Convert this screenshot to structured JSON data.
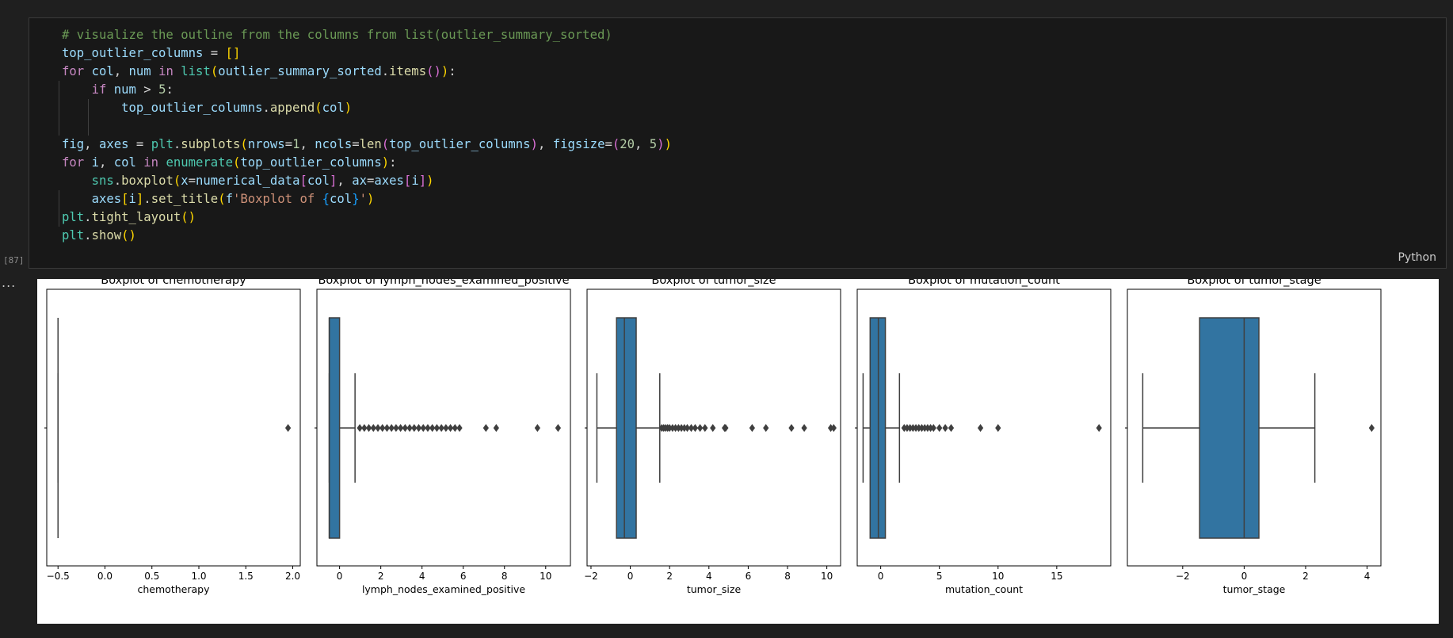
{
  "cell": {
    "execution_count": "[87]",
    "language": "Python",
    "output_menu": "...",
    "code_lines": [
      [
        [
          "cm",
          "# visualize the outline from the columns from list(outlier_summary_sorted)"
        ]
      ],
      [
        [
          "va",
          "top_outlier_columns"
        ],
        [
          "op",
          " = "
        ],
        [
          "b1",
          "[]"
        ]
      ],
      [
        [
          "kw",
          "for "
        ],
        [
          "va",
          "col"
        ],
        [
          "op",
          ", "
        ],
        [
          "va",
          "num"
        ],
        [
          "kw",
          " in "
        ],
        [
          "bi",
          "list"
        ],
        [
          "b1",
          "("
        ],
        [
          "va",
          "outlier_summary_sorted"
        ],
        [
          "op",
          "."
        ],
        [
          "fn",
          "items"
        ],
        [
          "b2",
          "()"
        ],
        [
          "b1",
          ")"
        ],
        [
          "op",
          ":"
        ]
      ],
      [
        [
          "op",
          "    "
        ],
        [
          "kw",
          "if "
        ],
        [
          "va",
          "num"
        ],
        [
          "op",
          " > "
        ],
        [
          "nu",
          "5"
        ],
        [
          "op",
          ":"
        ]
      ],
      [
        [
          "op",
          "        "
        ],
        [
          "va",
          "top_outlier_columns"
        ],
        [
          "op",
          "."
        ],
        [
          "fn",
          "append"
        ],
        [
          "b1",
          "("
        ],
        [
          "va",
          "col"
        ],
        [
          "b1",
          ")"
        ]
      ],
      [],
      [
        [
          "va",
          "fig"
        ],
        [
          "op",
          ", "
        ],
        [
          "va",
          "axes"
        ],
        [
          "op",
          " = "
        ],
        [
          "bi",
          "plt"
        ],
        [
          "op",
          "."
        ],
        [
          "fn",
          "subplots"
        ],
        [
          "b1",
          "("
        ],
        [
          "va",
          "nrows"
        ],
        [
          "op",
          "="
        ],
        [
          "nu",
          "1"
        ],
        [
          "op",
          ", "
        ],
        [
          "va",
          "ncols"
        ],
        [
          "op",
          "="
        ],
        [
          "fn",
          "len"
        ],
        [
          "b2",
          "("
        ],
        [
          "va",
          "top_outlier_columns"
        ],
        [
          "b2",
          ")"
        ],
        [
          "op",
          ", "
        ],
        [
          "va",
          "figsize"
        ],
        [
          "op",
          "="
        ],
        [
          "b2",
          "("
        ],
        [
          "nu",
          "20"
        ],
        [
          "op",
          ", "
        ],
        [
          "nu",
          "5"
        ],
        [
          "b2",
          ")"
        ],
        [
          "b1",
          ")"
        ]
      ],
      [
        [
          "kw",
          "for "
        ],
        [
          "va",
          "i"
        ],
        [
          "op",
          ", "
        ],
        [
          "va",
          "col"
        ],
        [
          "kw",
          " in "
        ],
        [
          "bi",
          "enumerate"
        ],
        [
          "b1",
          "("
        ],
        [
          "va",
          "top_outlier_columns"
        ],
        [
          "b1",
          ")"
        ],
        [
          "op",
          ":"
        ]
      ],
      [
        [
          "op",
          "    "
        ],
        [
          "bi",
          "sns"
        ],
        [
          "op",
          "."
        ],
        [
          "fn",
          "boxplot"
        ],
        [
          "b1",
          "("
        ],
        [
          "va",
          "x"
        ],
        [
          "op",
          "="
        ],
        [
          "va",
          "numerical_data"
        ],
        [
          "b2",
          "["
        ],
        [
          "va",
          "col"
        ],
        [
          "b2",
          "]"
        ],
        [
          "op",
          ", "
        ],
        [
          "va",
          "ax"
        ],
        [
          "op",
          "="
        ],
        [
          "va",
          "axes"
        ],
        [
          "b2",
          "["
        ],
        [
          "va",
          "i"
        ],
        [
          "b2",
          "]"
        ],
        [
          "b1",
          ")"
        ]
      ],
      [
        [
          "op",
          "    "
        ],
        [
          "va",
          "axes"
        ],
        [
          "b1",
          "["
        ],
        [
          "va",
          "i"
        ],
        [
          "b1",
          "]"
        ],
        [
          "op",
          "."
        ],
        [
          "fn",
          "set_title"
        ],
        [
          "b1",
          "("
        ],
        [
          "va",
          "f"
        ],
        [
          "st",
          "'Boxplot of "
        ],
        [
          "b3",
          "{"
        ],
        [
          "va",
          "col"
        ],
        [
          "b3",
          "}"
        ],
        [
          "st",
          "'"
        ],
        [
          "b1",
          ")"
        ]
      ],
      [
        [
          "bi",
          "plt"
        ],
        [
          "op",
          "."
        ],
        [
          "fn",
          "tight_layout"
        ],
        [
          "b1",
          "()"
        ]
      ],
      [
        [
          "bi",
          "plt"
        ],
        [
          "op",
          "."
        ],
        [
          "fn",
          "show"
        ],
        [
          "b1",
          "()"
        ]
      ]
    ]
  },
  "colors": {
    "box_fill": "#3274a1",
    "line": "#3f3f3f"
  },
  "chart_data": [
    {
      "type": "boxplot",
      "title": "Boxplot of chemotherapy",
      "xlabel": "chemotherapy",
      "xlim": [
        -0.62,
        2.08
      ],
      "xticks": [
        -0.5,
        0.0,
        0.5,
        1.0,
        1.5,
        2.0
      ],
      "xtick_labels": [
        "−0.5",
        "0.0",
        "0.5",
        "1.0",
        "1.5",
        "2.0"
      ],
      "whisker_low": -0.5,
      "q1": -0.5,
      "median": -0.5,
      "q3": -0.5,
      "whisker_high": -0.5,
      "outliers": [
        1.95
      ]
    },
    {
      "type": "boxplot",
      "title": "Boxplot of lymph_nodes_examined_positive",
      "xlabel": "lymph_nodes_examined_positive",
      "xlim": [
        -1.1,
        11.2
      ],
      "xticks": [
        0,
        2,
        4,
        6,
        8,
        10
      ],
      "xtick_labels": [
        "0",
        "2",
        "4",
        "6",
        "8",
        "10"
      ],
      "whisker_low": -0.5,
      "q1": -0.5,
      "median": -0.5,
      "q3": 0.0,
      "whisker_high": 0.75,
      "outliers": [
        0.98,
        1.2,
        1.42,
        1.64,
        1.86,
        2.08,
        2.3,
        2.52,
        2.74,
        2.96,
        3.18,
        3.4,
        3.62,
        3.84,
        4.06,
        4.28,
        4.5,
        4.72,
        4.94,
        5.16,
        5.38,
        5.6,
        5.82,
        7.1,
        7.6,
        9.6,
        10.6
      ]
    },
    {
      "type": "boxplot",
      "title": "Boxplot of tumor_size",
      "xlabel": "tumor_size",
      "xlim": [
        -2.2,
        10.7
      ],
      "xticks": [
        -2,
        0,
        2,
        4,
        6,
        8,
        10
      ],
      "xtick_labels": [
        "−2",
        "0",
        "2",
        "4",
        "6",
        "8",
        "10"
      ],
      "whisker_low": -1.7,
      "q1": -0.7,
      "median": -0.3,
      "q3": 0.3,
      "whisker_high": 1.5,
      "outliers": [
        1.6,
        1.7,
        1.8,
        1.9,
        2.0,
        2.15,
        2.3,
        2.45,
        2.6,
        2.75,
        2.9,
        3.1,
        3.3,
        3.55,
        3.8,
        4.2,
        4.8,
        4.85,
        6.2,
        6.9,
        8.2,
        8.85,
        10.2,
        10.35
      ]
    },
    {
      "type": "boxplot",
      "title": "Boxplot of mutation_count",
      "xlabel": "mutation_count",
      "xlim": [
        -2.0,
        19.6
      ],
      "xticks": [
        0,
        5,
        10,
        15
      ],
      "xtick_labels": [
        "0",
        "5",
        "10",
        "15"
      ],
      "whisker_low": -1.5,
      "q1": -0.9,
      "median": -0.2,
      "q3": 0.4,
      "whisker_high": 1.6,
      "outliers": [
        2.0,
        2.25,
        2.5,
        2.75,
        3.0,
        3.25,
        3.5,
        3.75,
        4.0,
        4.25,
        4.5,
        5.0,
        5.5,
        6.0,
        8.5,
        10.0,
        18.6
      ]
    },
    {
      "type": "boxplot",
      "title": "Boxplot of tumor_stage",
      "xlabel": "tumor_stage",
      "xlim": [
        -3.8,
        4.45
      ],
      "xticks": [
        -2,
        0,
        2,
        4
      ],
      "xtick_labels": [
        "−2",
        "0",
        "2",
        "4"
      ],
      "whisker_low": -3.3,
      "q1": -1.45,
      "median": 0.0,
      "q3": 0.48,
      "whisker_high": 2.3,
      "outliers": [
        4.15
      ]
    }
  ]
}
